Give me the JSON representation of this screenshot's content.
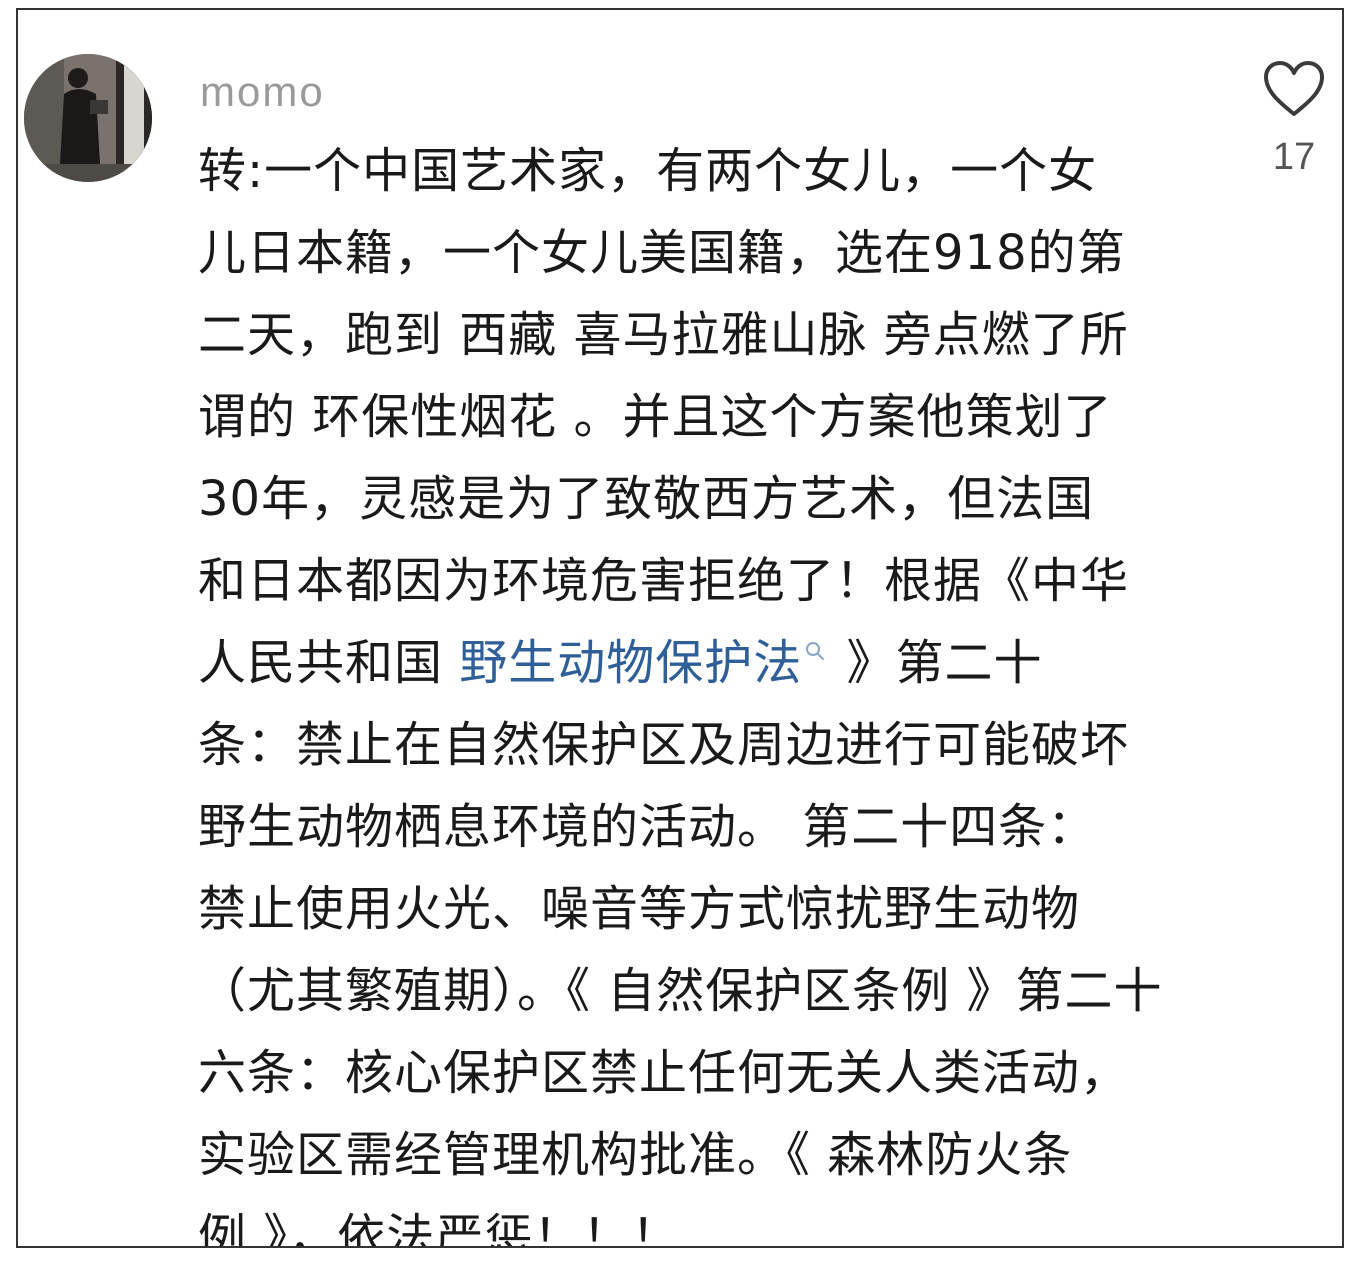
{
  "comment": {
    "username": "momo",
    "likes": "17",
    "lines": [
      {
        "parts": [
          {
            "text": "转:一个中国艺术家，有两个女儿，一个女"
          }
        ]
      },
      {
        "parts": [
          {
            "text": "儿日本籍，一个女儿美国籍，选在918的第"
          }
        ]
      },
      {
        "parts": [
          {
            "text": "二天，跑到 西藏 喜马拉雅山脉 旁点燃了所"
          }
        ]
      },
      {
        "parts": [
          {
            "text": "谓的 环保性烟花 。并且这个方案他策划了"
          }
        ]
      },
      {
        "parts": [
          {
            "text": " 30年，灵感是为了致敬西方艺术，但法国"
          }
        ]
      },
      {
        "parts": [
          {
            "text": "和日本都因为环境危害拒绝了！根据《中华"
          }
        ]
      },
      {
        "parts": [
          {
            "text": "人民共和国 "
          },
          {
            "text": "野生动物保护法",
            "link": true
          },
          {
            "icon": "search-icon"
          },
          {
            "text": " 》第二十"
          }
        ]
      },
      {
        "parts": [
          {
            "text": "条：禁止在自然保护区及周边进行可能破坏"
          }
        ]
      },
      {
        "parts": [
          {
            "text": "野生动物栖息环境的活动。 第二十四条："
          }
        ]
      },
      {
        "parts": [
          {
            "text": "禁止使用火光、噪音等方式惊扰野生动物"
          }
        ]
      },
      {
        "parts": [
          {
            "text": "（尤其繁殖期）。《 自然保护区条例 》第二十"
          }
        ]
      },
      {
        "parts": [
          {
            "text": "六条：核心保护区禁止任何无关人类活动，"
          }
        ]
      },
      {
        "parts": [
          {
            "text": "实验区需经管理机构批准。《 森林防火条"
          }
        ]
      },
      {
        "parts": [
          {
            "text": "例 》，依法严惩！！！"
          }
        ]
      }
    ]
  },
  "colors": {
    "link": "#2f5f98",
    "text": "#1a1a1a",
    "username": "#9a9a9a",
    "count": "#555555"
  },
  "icons": {
    "like": "heart-icon",
    "search": "search-icon",
    "avatar": "avatar"
  }
}
